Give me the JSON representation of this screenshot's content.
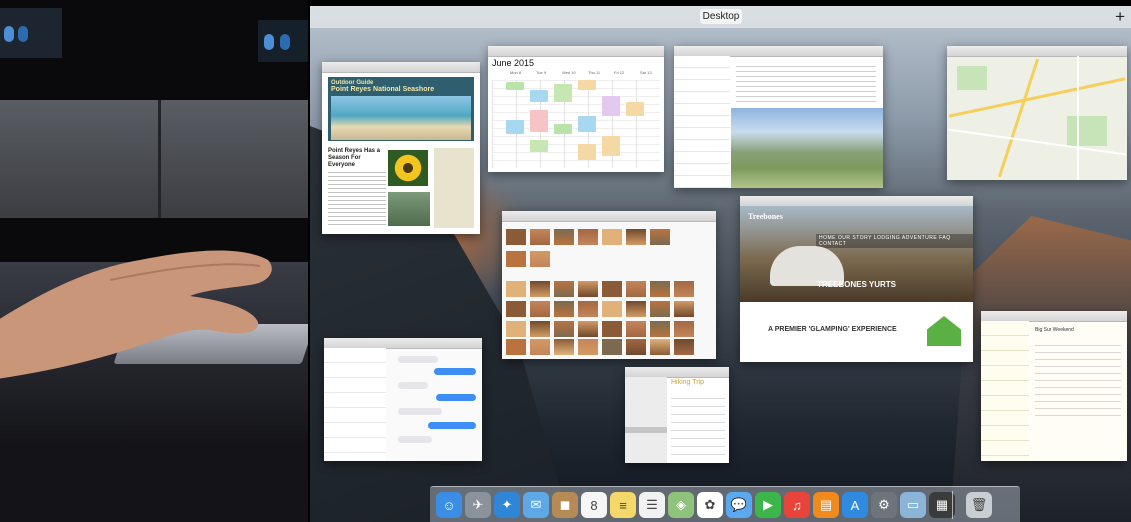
{
  "mission_control": {
    "space_label": "Desktop",
    "add_space": "+"
  },
  "windows": {
    "newsletter": {
      "header": "Outdoor Guide",
      "title": "Point Reyes National Seashore",
      "headline": "Point Reyes Has a Season For Everyone"
    },
    "calendar": {
      "month": "June 2015",
      "days": [
        "Mon 8",
        "Tue 9",
        "Wed 10",
        "Thu 11",
        "Fri 12",
        "Sat 13"
      ]
    },
    "yurts": {
      "logo": "Treebones",
      "nav": "HOME  OUR STORY  LODGING  ADVENTURE  FAQ  CONTACT",
      "hero_title": "TREEBONES YURTS",
      "tagline": "A PREMIER 'GLAMPING' EXPERIENCE"
    },
    "hiking_note": {
      "title": "Hiking Trip"
    },
    "notes": {
      "title": "Big Sur Weekend"
    }
  },
  "dock": {
    "items": [
      {
        "name": "finder-icon",
        "color": "#3a8ee6",
        "glyph": "☺"
      },
      {
        "name": "launchpad-icon",
        "color": "#8a939c",
        "glyph": "✈"
      },
      {
        "name": "safari-icon",
        "color": "#2f86d6",
        "glyph": "✦"
      },
      {
        "name": "mail-icon",
        "color": "#5fa8e8",
        "glyph": "✉"
      },
      {
        "name": "contacts-icon",
        "color": "#b68a55",
        "glyph": "◼"
      },
      {
        "name": "calendar-icon",
        "color": "#f6f6f6",
        "glyph": "8"
      },
      {
        "name": "notes-icon",
        "color": "#f4d86a",
        "glyph": "≡"
      },
      {
        "name": "reminders-icon",
        "color": "#f2f2f2",
        "glyph": "☰"
      },
      {
        "name": "maps-icon",
        "color": "#8fc27a",
        "glyph": "◈"
      },
      {
        "name": "photos-icon",
        "color": "#ffffff",
        "glyph": "✿"
      },
      {
        "name": "messages-icon",
        "color": "#5aa9f0",
        "glyph": "💬"
      },
      {
        "name": "facetime-icon",
        "color": "#3cb54a",
        "glyph": "▶"
      },
      {
        "name": "music-icon",
        "color": "#e8443a",
        "glyph": "♫"
      },
      {
        "name": "ibooks-icon",
        "color": "#f08a1c",
        "glyph": "▤"
      },
      {
        "name": "app-store-icon",
        "color": "#2f8ae0",
        "glyph": "A"
      },
      {
        "name": "system-preferences-icon",
        "color": "#6d747c",
        "glyph": "⚙"
      },
      {
        "name": "preview-icon",
        "color": "#8ab4d8",
        "glyph": "▭"
      },
      {
        "name": "downloads-icon",
        "color": "#3b3b3b",
        "glyph": "▦"
      },
      {
        "name": "trash-icon",
        "color": "#c9ced3",
        "glyph": "🗑"
      }
    ]
  }
}
